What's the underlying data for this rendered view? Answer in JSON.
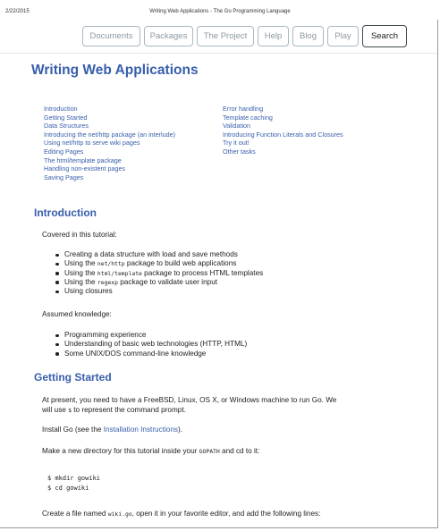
{
  "print_header": {
    "date": "2/22/2015",
    "title": "Writing Web Applications - The Go Programming Language"
  },
  "nav": {
    "documents": "Documents",
    "packages": "Packages",
    "project": "The Project",
    "help": "Help",
    "blog": "Blog",
    "play": "Play",
    "search": "Search"
  },
  "page_title": "Writing Web Applications",
  "toc": {
    "left": [
      "Introduction",
      "Getting Started",
      "Data Structures",
      "Introducing the net/http package (an interlude)",
      "Using net/http to serve wiki pages",
      "Editing Pages",
      "The html/template package",
      "Handling non-existent pages",
      "Saving Pages"
    ],
    "right": [
      "Error handling",
      "Template caching",
      "Validation",
      "Introducing Function Literals and Closures",
      "Try it out!",
      "Other tasks"
    ]
  },
  "intro": {
    "heading": "Introduction",
    "covered": "Covered in this tutorial:",
    "b1": "Creating a data structure with load and save methods",
    "b2_pre": "Using the ",
    "b2_code": "net/http",
    "b2_post": " package to build web applications",
    "b3_pre": "Using the ",
    "b3_code": "html/template",
    "b3_post": " package to process HTML templates",
    "b4_pre": "Using the ",
    "b4_code": "regexp",
    "b4_post": " package to validate user input",
    "b5": "Using closures",
    "assumed": "Assumed knowledge:",
    "k1": "Programming experience",
    "k2": "Understanding of basic web technologies (HTTP, HTML)",
    "k3": "Some UNIX/DOS command-line knowledge"
  },
  "getting_started": {
    "heading": "Getting Started",
    "p1_line1": "At present, you need to have a FreeBSD, Linux, OS X, or Windows machine to run Go. We",
    "p1_pre": "will use ",
    "p1_code": "$",
    "p1_post": " to represent the command prompt.",
    "p2_pre": "Install Go (see the ",
    "p2_link": "Installation Instructions",
    "p2_post": ").",
    "p3_pre": "Make a new directory for this tutorial inside your ",
    "p3_code": "GOPATH",
    "p3_post": " and cd to it:",
    "code_line1": "$ mkdir gowiki",
    "code_line2": "$ cd gowiki",
    "p4_pre": "Create a file named ",
    "p4_code": "wiki.go",
    "p4_post": ", open it in your favorite editor, and add the following lines:"
  }
}
